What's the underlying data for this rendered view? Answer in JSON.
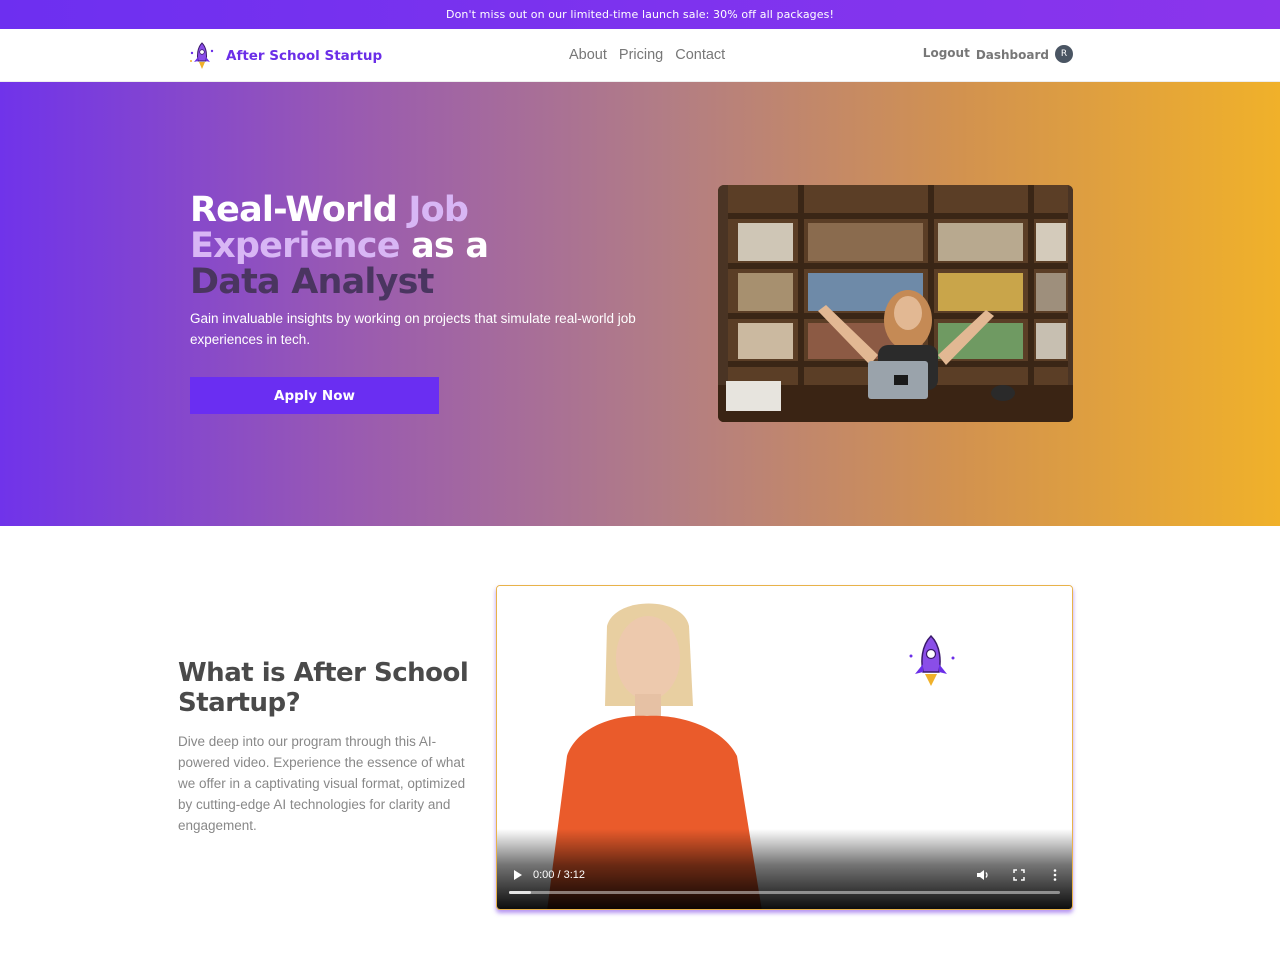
{
  "announcement": "Don't miss out on our limited-time launch sale: 30% off all packages!",
  "brand": {
    "name": "After School Startup",
    "logo_icon": "rocket-icon"
  },
  "nav": {
    "links": [
      "About",
      "Pricing",
      "Contact"
    ],
    "logout": "Logout",
    "dashboard": "Dashboard",
    "avatar_initial": "R"
  },
  "hero": {
    "title_parts": [
      "Real-World",
      "Job Experience",
      "as a",
      "Data Analyst"
    ],
    "subtitle": "Gain invaluable insights by working on projects that simulate real-world job experiences in tech.",
    "cta": "Apply Now",
    "image": "student-at-bookshelf-photo"
  },
  "about": {
    "title": "What is After School Startup?",
    "text": "Dive deep into our program through this AI-powered video. Experience the essence of what we offer in a captivating visual format, optimized by cutting-edge AI technologies for clarity and engagement."
  },
  "video": {
    "time": "0:00 / 3:12",
    "progress": 0.04
  },
  "colors": {
    "brand": "#6b2ee8",
    "cta": "#6a2ef2",
    "gradient_start": "#7033ea",
    "gradient_end": "#f0b12a"
  }
}
